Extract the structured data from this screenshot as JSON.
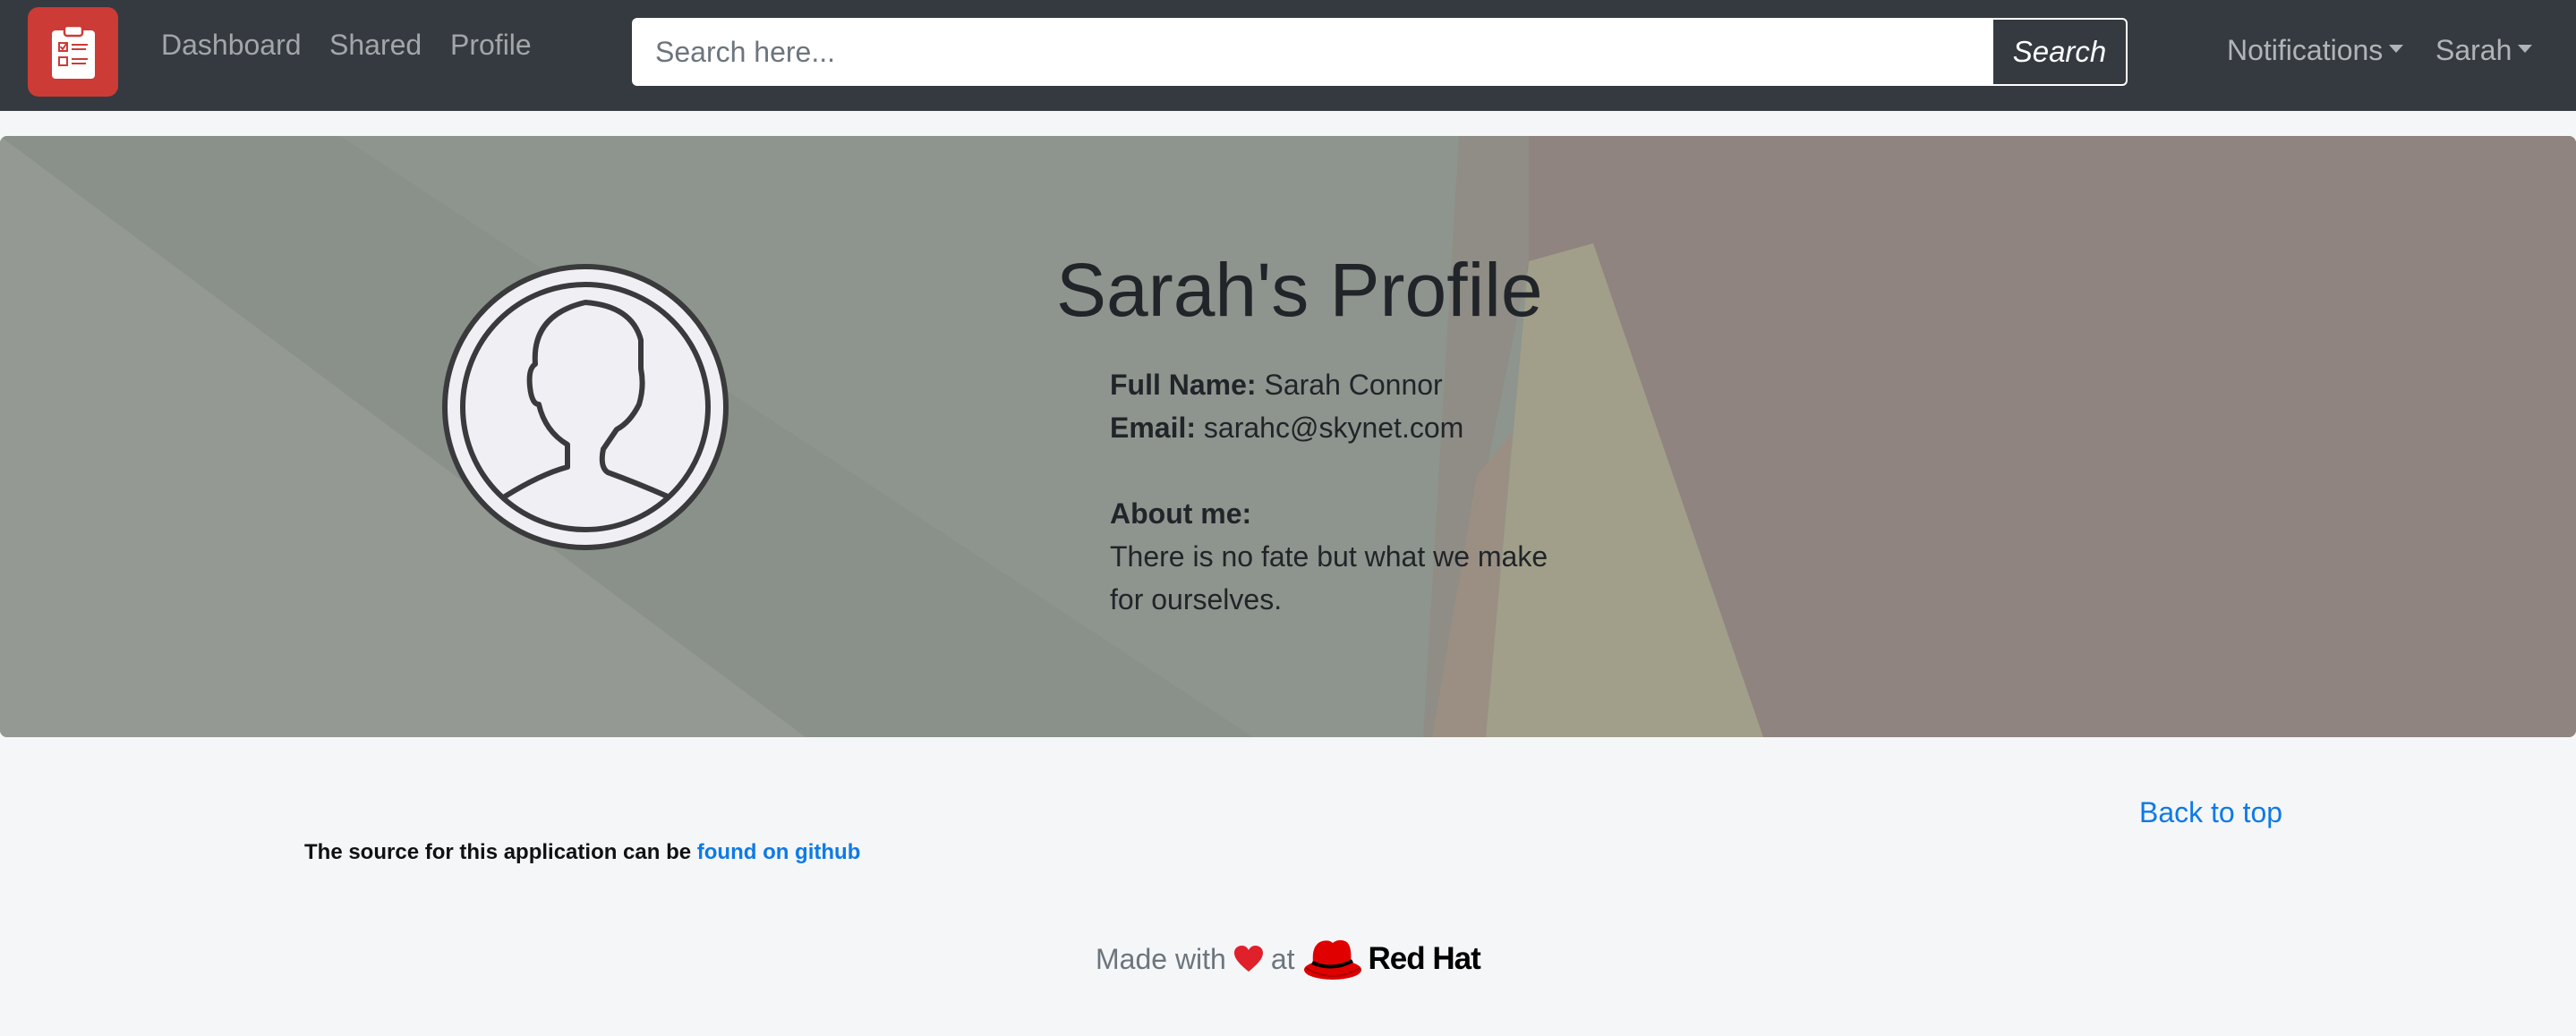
{
  "nav": {
    "links": [
      "Dashboard",
      "Shared",
      "Profile"
    ],
    "search_placeholder": "Search here...",
    "search_button": "Search",
    "notifications": "Notifications",
    "user": "Sarah"
  },
  "profile": {
    "title": "Sarah's Profile",
    "full_name_label": "Full Name:",
    "full_name": "Sarah Connor",
    "email_label": "Email:",
    "email": "sarahc@skynet.com",
    "about_label": "About me:",
    "about_line1": "There is no fate but what we make",
    "about_line2": "for ourselves."
  },
  "footer": {
    "back_to_top": "Back to top",
    "source_text": "The source for this application can be",
    "source_link": "found on github",
    "made_with": "Made with",
    "at": "at",
    "brand": "Red Hat"
  },
  "colors": {
    "navbar": "#343a40",
    "brand_red": "#cc3b36",
    "link_blue": "#0d7ae6",
    "page_bg": "#f5f6f8"
  },
  "icons": {
    "brand": "clipboard-icon",
    "avatar": "user-avatar-icon",
    "heart": "heart-icon",
    "redhat": "redhat-fedora-icon"
  }
}
